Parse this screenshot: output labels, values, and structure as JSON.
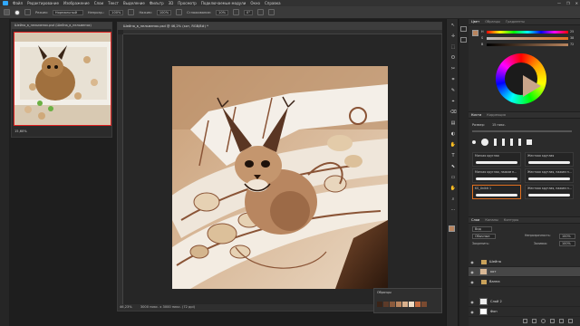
{
  "menubar": {
    "items": [
      "Файл",
      "Редактирование",
      "Изображение",
      "Слои",
      "Текст",
      "Выделение",
      "Фильтр",
      "3D",
      "Просмотр",
      "Подключаемые модули",
      "Окно",
      "Справка"
    ],
    "window_controls": [
      "—",
      "❐",
      "✕"
    ]
  },
  "options": {
    "mode_label": "Режим:",
    "mode_value": "Нормальный",
    "opacity_label": "Непрозр.:",
    "opacity_value": "100%",
    "pressure_label": "Нажим:",
    "pressure_value": "100%",
    "smooth_label": "Сглаживание:",
    "smooth_value": "10%",
    "angle_value": "0°"
  },
  "navigator": {
    "tab": "Шейна_в_пельменях.psd (Шейна_в_пельменях)",
    "zoom": "15,60%"
  },
  "document": {
    "tab": "Шейна_в_пельменях.psd @ 46,2% (кот, RGB/8#) *",
    "status": "46,23%",
    "dims": "3000 пикс. x 3000 пикс. (72 ppi)"
  },
  "swatches_float": {
    "title": "Образцы",
    "colors": [
      "#3a2418",
      "#5c3a28",
      "#8a5a3c",
      "#b8845e",
      "#d9b08c",
      "#f0dcc4",
      "#c46b3e",
      "#7a4a30"
    ]
  },
  "tools": [
    "↖",
    "✛",
    "⬚",
    "ʘ",
    "✂",
    "⌗",
    "✎",
    "⌖",
    "⌫",
    "▤",
    "◐",
    "✋",
    "T",
    "⬉",
    "▭",
    "✋",
    "⌕",
    "⋯"
  ],
  "colors": {
    "fg": "#b8845e",
    "bg": "#ffffff",
    "accent": "#31a8ff",
    "brown": "#7a4a30"
  },
  "color_panel": {
    "tabs": [
      "Цвет",
      "Образцы",
      "Градиенты"
    ],
    "h_label": "H",
    "s_label": "S",
    "b_label": "B",
    "h_value": "25",
    "s_value": "38",
    "b_value": "72"
  },
  "brushes": {
    "tabs": [
      "Кисти",
      "Коррекция"
    ],
    "size_label": "Размер:",
    "size_value": "15 пикс.",
    "items": [
      {
        "name": "Мягкая круглая"
      },
      {
        "name": "Жесткая круглая"
      },
      {
        "name": "Мягкая круглая, нажим н..."
      },
      {
        "name": "Жесткая круглая, нажим н..."
      },
      {
        "name": "KS_Unikit 1"
      },
      {
        "name": "Жесткая круглая, нажим н..."
      }
    ]
  },
  "layers": {
    "tabs": [
      "Слои",
      "Каналы",
      "Контуры"
    ],
    "filter": "Вид",
    "blend": "Обычные",
    "opacity_label": "Непрозрачность:",
    "opacity_value": "100%",
    "lock_label": "Закрепить:",
    "fill_label": "Заливка:",
    "fill_value": "100%",
    "rows": [
      {
        "name": "Шейна",
        "type": "group"
      },
      {
        "name": "кот",
        "type": "layer"
      },
      {
        "name": "Ванна",
        "type": "group"
      },
      {
        "name": "Слой 2",
        "type": "layer"
      },
      {
        "name": "Фон",
        "type": "layer"
      }
    ]
  }
}
